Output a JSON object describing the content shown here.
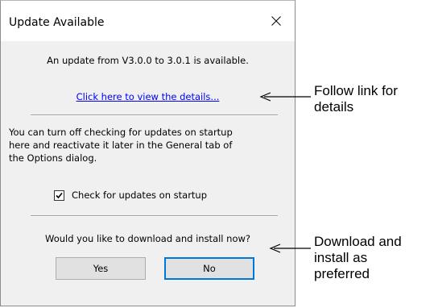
{
  "dialog": {
    "title": "Update Available",
    "message": "An update from V3.0.0 to 3.0.1 is available.",
    "details_link": "Click here to view the details...",
    "info_lines": [
      "You can turn off checking for updates on startup",
      "here and reactivate it later in the General tab of",
      "the Options dialog."
    ],
    "checkbox": {
      "label": "Check for updates on startup",
      "checked": true
    },
    "question": "Would you like to download and install now?",
    "yes_label": "Yes",
    "no_label": "No"
  },
  "annotations": {
    "link_callout": [
      "Follow link for",
      "details"
    ],
    "buttons_callout": [
      "Download and",
      "install as",
      "preferred"
    ]
  },
  "colors": {
    "link": "#0000ff",
    "focus_border": "#0078d7",
    "dialog_bg": "#f0f0f0"
  },
  "icons": [
    "close-icon",
    "checkmark-icon",
    "arrow-left-icon"
  ]
}
